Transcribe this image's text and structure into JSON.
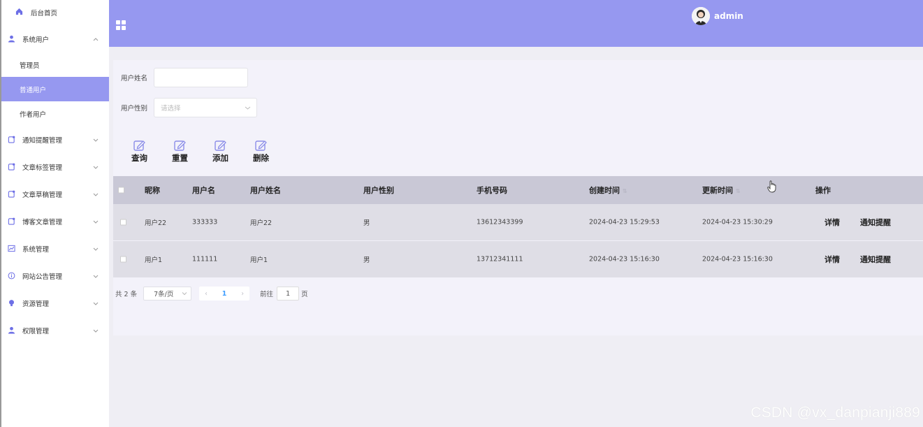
{
  "sidebar": {
    "home": "后台首页",
    "groups": [
      {
        "label": "系统用户",
        "icon": "user-icon",
        "expanded": true,
        "children": [
          {
            "label": "管理员"
          },
          {
            "label": "普通用户",
            "active": true
          },
          {
            "label": "作者用户"
          }
        ]
      },
      {
        "label": "通知提醒管理",
        "icon": "notice-icon"
      },
      {
        "label": "文章标签管理",
        "icon": "tag-icon"
      },
      {
        "label": "文章草稿管理",
        "icon": "draft-icon"
      },
      {
        "label": "博客文章管理",
        "icon": "article-icon"
      },
      {
        "label": "系统管理",
        "icon": "chart-icon"
      },
      {
        "label": "网站公告管理",
        "icon": "info-icon"
      },
      {
        "label": "资源管理",
        "icon": "bulb-icon"
      },
      {
        "label": "权限管理",
        "icon": "user-icon"
      }
    ]
  },
  "header": {
    "username": "admin"
  },
  "filters": {
    "name_label": "用户姓名",
    "name_value": "",
    "gender_label": "用户性别",
    "gender_placeholder": "请选择"
  },
  "toolbar": {
    "query": "查询",
    "reset": "重置",
    "add": "添加",
    "delete": "删除"
  },
  "table": {
    "columns": [
      "昵称",
      "用户名",
      "用户姓名",
      "用户性别",
      "手机号码",
      "创建时间",
      "更新时间",
      "操作"
    ],
    "rows": [
      {
        "nickname": "用户22",
        "username": "333333",
        "realname": "用户22",
        "gender": "男",
        "phone": "13612343399",
        "created": "2024-04-23 15:29:53",
        "updated": "2024-04-23 15:30:29"
      },
      {
        "nickname": "用户1",
        "username": "111111",
        "realname": "用户1",
        "gender": "男",
        "phone": "13712341111",
        "created": "2024-04-23 15:16:30",
        "updated": "2024-04-23 15:16:30"
      }
    ],
    "actions": {
      "detail": "详情",
      "notify": "通知提醒"
    }
  },
  "pagination": {
    "total": "共 2 条",
    "page_size": "7条/页",
    "current_page": "1",
    "goto_label": "前往",
    "goto_value": "1",
    "page_suffix": "页"
  },
  "watermark": "CSDN @vx_danpianji889",
  "colors": {
    "accent": "#9698f0",
    "header_bg": "#9698f0",
    "active_item": "#9698f0"
  }
}
